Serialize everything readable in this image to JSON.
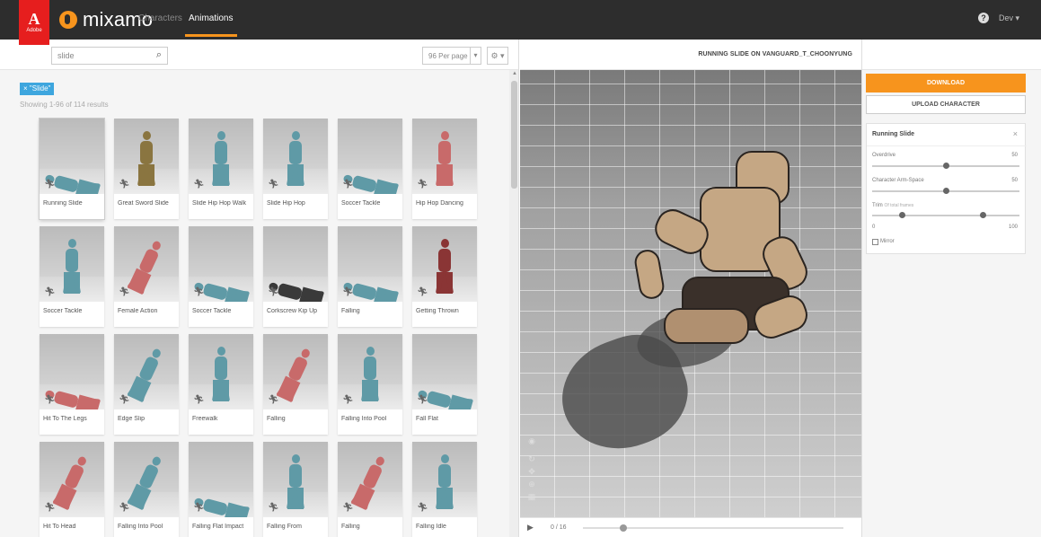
{
  "header": {
    "adobe_logo_text": "Adobe",
    "brand": "mixamo",
    "tabs": [
      "Characters",
      "Animations"
    ],
    "active_tab": "Animations",
    "user_menu": "Dev"
  },
  "search": {
    "value": "slide",
    "per_page": "96 Per page",
    "filter_tag": "\"Slide\"",
    "results": "Showing 1-96 of 114 results"
  },
  "animations": [
    {
      "label": "Running Slide",
      "color": "#5f9aa6",
      "pose": "lying",
      "selected": true
    },
    {
      "label": "Great Sword Slide",
      "color": "#8a7540",
      "pose": "stand",
      "selected": false
    },
    {
      "label": "Slide Hip Hop Walk",
      "color": "#5f9aa6",
      "pose": "stand",
      "selected": false
    },
    {
      "label": "Slide Hip Hop",
      "color": "#5f9aa6",
      "pose": "stand",
      "selected": false
    },
    {
      "label": "Soccer Tackle",
      "color": "#5f9aa6",
      "pose": "lying",
      "selected": false
    },
    {
      "label": "Hip Hop Dancing",
      "color": "#c86a6a",
      "pose": "stand",
      "selected": false
    },
    {
      "label": "Soccer Tackle",
      "color": "#5f9aa6",
      "pose": "stand",
      "selected": false
    },
    {
      "label": "Female Action",
      "color": "#c86a6a",
      "pose": "bent",
      "selected": false
    },
    {
      "label": "Soccer Tackle",
      "color": "#5f9aa6",
      "pose": "lying",
      "selected": false
    },
    {
      "label": "Corkscrew Kip Up",
      "color": "#3a3a3a",
      "pose": "lying",
      "selected": false
    },
    {
      "label": "Falling",
      "color": "#5f9aa6",
      "pose": "lying",
      "selected": false
    },
    {
      "label": "Getting Thrown",
      "color": "#8a3535",
      "pose": "stand",
      "selected": false
    },
    {
      "label": "Hit To The Legs",
      "color": "#c86a6a",
      "pose": "lying",
      "selected": false
    },
    {
      "label": "Edge Slip",
      "color": "#5f9aa6",
      "pose": "bent",
      "selected": false
    },
    {
      "label": "Freewalk",
      "color": "#5f9aa6",
      "pose": "stand",
      "selected": false
    },
    {
      "label": "Falling",
      "color": "#c86a6a",
      "pose": "bent",
      "selected": false
    },
    {
      "label": "Falling Into Pool",
      "color": "#5f9aa6",
      "pose": "stand",
      "selected": false
    },
    {
      "label": "Fall Flat",
      "color": "#5f9aa6",
      "pose": "lying",
      "selected": false
    },
    {
      "label": "Hit To Head",
      "color": "#c86a6a",
      "pose": "bent",
      "selected": false
    },
    {
      "label": "Falling Into Pool",
      "color": "#5f9aa6",
      "pose": "bent",
      "selected": false
    },
    {
      "label": "Falling Flat Impact",
      "color": "#5f9aa6",
      "pose": "lying",
      "selected": false
    },
    {
      "label": "Falling From",
      "color": "#5f9aa6",
      "pose": "stand",
      "selected": false
    },
    {
      "label": "Falling",
      "color": "#c86a6a",
      "pose": "bent",
      "selected": false
    },
    {
      "label": "Falling Idle",
      "color": "#5f9aa6",
      "pose": "stand",
      "selected": false
    }
  ],
  "viewer": {
    "title": "RUNNING SLIDE ON VANGUARD_T_CHOONYUNG",
    "frame": "0 / 16",
    "progress": 0.15
  },
  "panel": {
    "download": "DOWNLOAD",
    "upload": "UPLOAD CHARACTER",
    "settings_title": "Running Slide",
    "overdrive_label": "Overdrive",
    "overdrive_value": "50",
    "overdrive": 0.5,
    "arm_label": "Character Arm-Space",
    "arm_value": "50",
    "arm": 0.5,
    "trim_label": "Trim",
    "trim_sub": "Of total frames",
    "trim_min": "0",
    "trim_max": "100",
    "trim_start": 0.2,
    "trim_end": 0.75,
    "mirror_label": "Mirror"
  },
  "colors": {
    "accent": "#f7941d",
    "adobe_red": "#e61e1e",
    "tag_blue": "#3ea6de"
  }
}
